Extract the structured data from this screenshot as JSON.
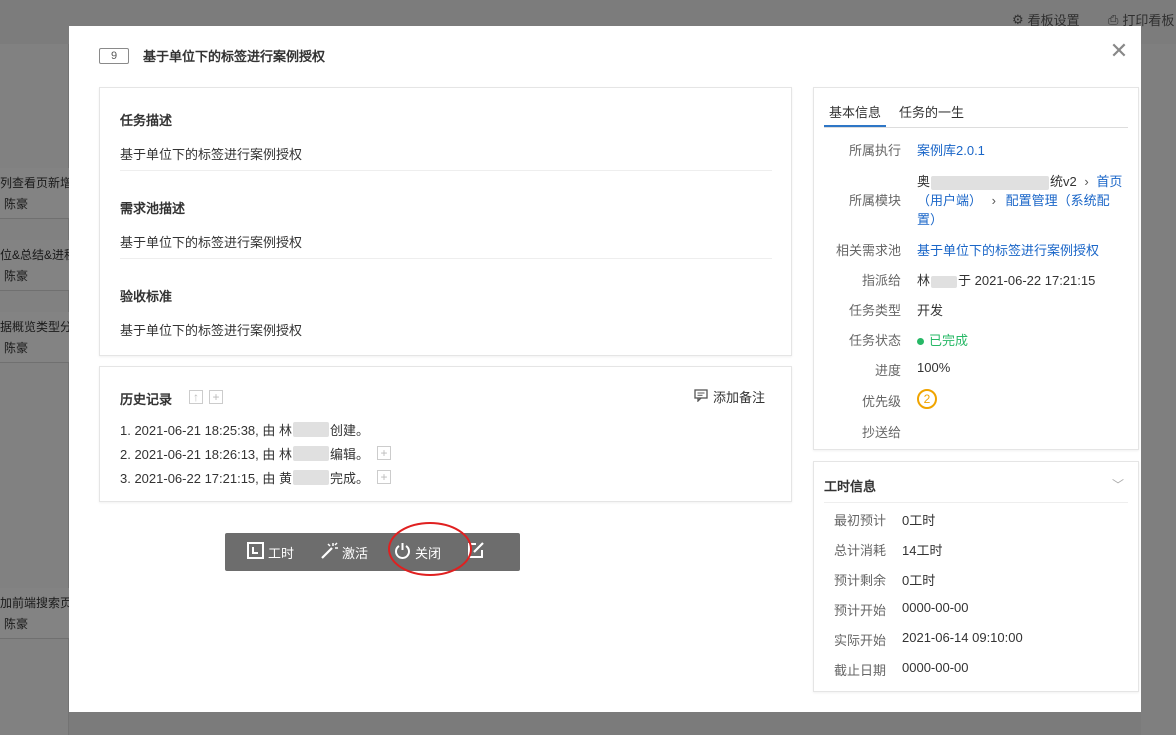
{
  "background": {
    "tools": [
      "看板设置",
      "打印看板"
    ],
    "cards": [
      {
        "title": "列查看页新增",
        "user": "陈豪"
      },
      {
        "title": "位&总结&进程",
        "user": "陈豪"
      },
      {
        "title": "据概览类型分",
        "user": "陈豪"
      },
      {
        "title": "加前端搜索页",
        "user": "陈豪"
      }
    ]
  },
  "modal": {
    "id": "9",
    "title": "基于单位下的标签进行案例授权",
    "close_icon": "close-icon"
  },
  "description": {
    "task_desc_title": "任务描述",
    "task_desc_text": "基于单位下的标签进行案例授权",
    "req_desc_title": "需求池描述",
    "req_desc_text": "基于单位下的标签进行案例授权",
    "accept_title": "验收标准",
    "accept_text": "基于单位下的标签进行案例授权"
  },
  "history": {
    "title": "历史记录",
    "add_note": "添加备注",
    "items": [
      {
        "prefix": "1. 2021-06-21 18:25:38, 由 林",
        "suffix": "创建。"
      },
      {
        "prefix": "2. 2021-06-21 18:26:13, 由 林",
        "suffix": "编辑。"
      },
      {
        "prefix": "3. 2021-06-22 17:21:15, 由 黄",
        "suffix": "完成。"
      }
    ]
  },
  "toolbar": {
    "worktime": "工时",
    "activate": "激活",
    "close": "关闭"
  },
  "info": {
    "tab_basic": "基本信息",
    "tab_life": "任务的一生",
    "exec_label": "所属执行",
    "exec_value": "案例库2.0.1",
    "module_label": "所属模块",
    "module_line1_tail": "统v2",
    "module_home": "首页",
    "module_user": "（用户端）",
    "module_config": "配置管理（系统配",
    "module_config_end": "置）",
    "req_label": "相关需求池",
    "req_value": "基于单位下的标签进行案例授权",
    "assign_label": "指派给",
    "assign_value": "林",
    "assign_time": "于 2021-06-22 17:21:15",
    "type_label": "任务类型",
    "type_value": "开发",
    "status_label": "任务状态",
    "status_value": "已完成",
    "progress_label": "进度",
    "progress_value": "100%",
    "priority_label": "优先级",
    "priority_value": "2",
    "cc_label": "抄送给",
    "cc_value": ""
  },
  "time": {
    "title": "工时信息",
    "rows": [
      {
        "k": "最初预计",
        "v": "0工时"
      },
      {
        "k": "总计消耗",
        "v": "14工时"
      },
      {
        "k": "预计剩余",
        "v": "0工时"
      },
      {
        "k": "预计开始",
        "v": "0000-00-00"
      },
      {
        "k": "实际开始",
        "v": "2021-06-14 09:10:00"
      },
      {
        "k": "截止日期",
        "v": "0000-00-00"
      }
    ]
  },
  "colors": {
    "link": "#1a66c8",
    "status_done": "#27b866",
    "priority": "#f0a400",
    "highlight_ring": "#e02020"
  }
}
